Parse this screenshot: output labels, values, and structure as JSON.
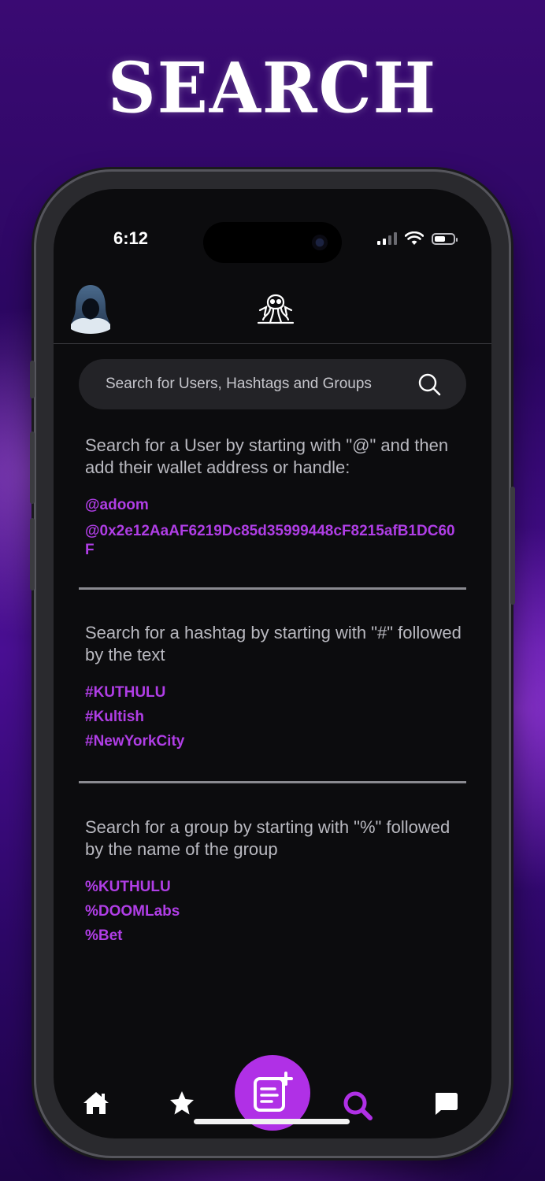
{
  "headline": "SEARCH",
  "status_bar": {
    "time": "6:12"
  },
  "search": {
    "placeholder": "Search for Users, Hashtags and Groups"
  },
  "sections": [
    {
      "description": "Search for a User by starting with \"@\" and then add their wallet address or handle:",
      "examples": [
        "@adoom",
        "@0x2e12AaAF6219Dc85d35999448cF8215afB1DC60F"
      ]
    },
    {
      "description": "Search for a hashtag by starting with \"#\" followed by the text",
      "examples": [
        "#KUTHULU",
        "#Kultish",
        "#NewYorkCity"
      ]
    },
    {
      "description": "Search for a group by starting with \"%\" followed by the name of the group",
      "examples": [
        "%KUTHULU",
        "%DOOMLabs",
        "%Bet"
      ]
    }
  ],
  "nav": {
    "items": [
      "home-icon",
      "star-icon",
      "compose-icon",
      "search-icon",
      "chat-icon"
    ],
    "active": "search-icon",
    "accent": "#b030e6"
  },
  "colors": {
    "link": "#b03ee6",
    "screen_bg": "#0c0c0e",
    "search_bg": "#232327"
  }
}
